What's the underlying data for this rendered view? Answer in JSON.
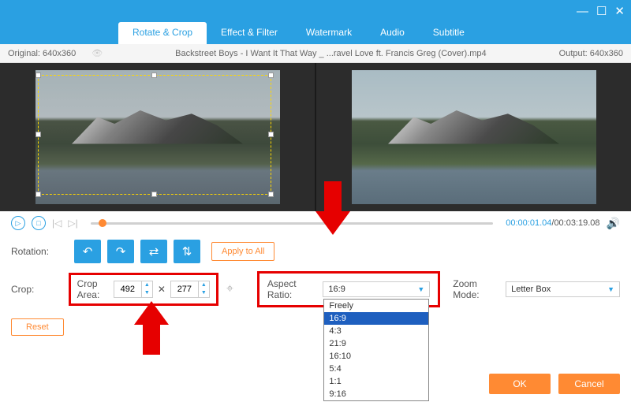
{
  "titlebar": {
    "minimize": "—",
    "maximize": "☐",
    "close": "✕"
  },
  "tabs": {
    "items": [
      {
        "label": "Rotate & Crop",
        "active": true
      },
      {
        "label": "Effect & Filter"
      },
      {
        "label": "Watermark"
      },
      {
        "label": "Audio"
      },
      {
        "label": "Subtitle"
      }
    ]
  },
  "infobar": {
    "original_label": "Original:",
    "original_value": "640x360",
    "filename": "Backstreet Boys - I Want It That Way _ ...ravel Love ft. Francis Greg (Cover).mp4",
    "output_label": "Output:",
    "output_value": "640x360"
  },
  "playback": {
    "current": "00:00:01.04",
    "total": "00:03:19.08"
  },
  "rotation": {
    "label": "Rotation:",
    "apply_all": "Apply to All"
  },
  "crop": {
    "label": "Crop:",
    "area_label": "Crop Area:",
    "width": "492",
    "height": "277",
    "reset": "Reset"
  },
  "aspect": {
    "label": "Aspect Ratio:",
    "selected": "16:9",
    "options": [
      "Freely",
      "16:9",
      "4:3",
      "21:9",
      "16:10",
      "5:4",
      "1:1",
      "9:16"
    ]
  },
  "zoom": {
    "label": "Zoom Mode:",
    "selected": "Letter Box"
  },
  "footer": {
    "ok": "OK",
    "cancel": "Cancel"
  }
}
